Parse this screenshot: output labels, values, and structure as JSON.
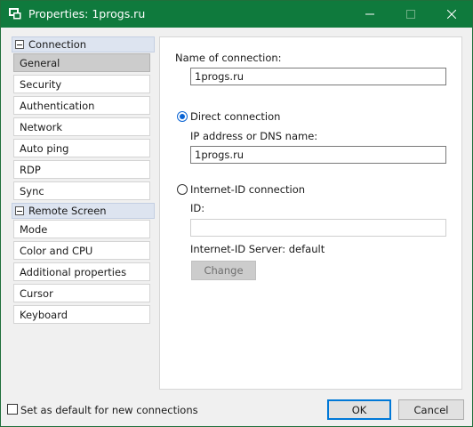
{
  "window": {
    "title": "Properties: 1progs.ru",
    "title_bar_color": "#0f7a3d"
  },
  "sidebar": {
    "groups": [
      {
        "label": "Connection",
        "items": [
          "General",
          "Security",
          "Authentication",
          "Network",
          "Auto ping",
          "RDP",
          "Sync"
        ]
      },
      {
        "label": "Remote Screen",
        "items": [
          "Mode",
          "Color and CPU",
          "Additional properties",
          "Cursor",
          "Keyboard"
        ]
      }
    ],
    "selected_item": "General"
  },
  "general": {
    "name_label": "Name of connection:",
    "name_value": "1progs.ru",
    "direct_label": "Direct connection",
    "direct_checked": true,
    "ip_label": "IP address or DNS name:",
    "ip_value": "1progs.ru",
    "internet_id_label": "Internet-ID connection",
    "internet_id_checked": false,
    "id_label": "ID:",
    "id_value": "",
    "server_label": "Internet-ID Server: default",
    "change_label": "Change"
  },
  "footer": {
    "default_checkbox_label": "Set as default for new connections",
    "default_checked": false,
    "ok_label": "OK",
    "cancel_label": "Cancel"
  },
  "icons": {
    "app": "app-icon",
    "minimize": "minimize-icon",
    "maximize": "maximize-icon",
    "close": "close-icon",
    "collapse": "collapse-icon"
  }
}
